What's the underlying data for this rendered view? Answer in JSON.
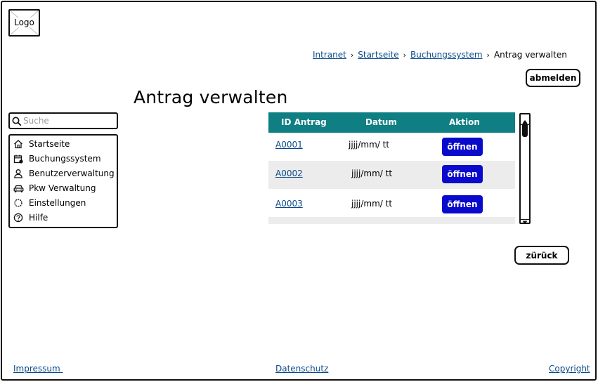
{
  "logo": {
    "text": "Logo"
  },
  "breadcrumb": {
    "items": [
      "Intranet",
      "Startseite",
      "Buchungssystem"
    ],
    "current": "Antrag verwalten",
    "separator": "›"
  },
  "header": {
    "logout_label": "abmelden"
  },
  "page": {
    "title": "Antrag verwalten"
  },
  "search": {
    "placeholder": "Suche",
    "value": ""
  },
  "sidebar": {
    "items": [
      {
        "label": "Startseite",
        "icon": "home-icon"
      },
      {
        "label": "Buchungssystem",
        "icon": "calendar-icon"
      },
      {
        "label": "Benutzerverwaltung",
        "icon": "user-icon"
      },
      {
        "label": "Pkw Verwaltung",
        "icon": "car-icon"
      },
      {
        "label": "Einstellungen",
        "icon": "gear-icon"
      },
      {
        "label": "Hilfe",
        "icon": "help-icon"
      }
    ]
  },
  "table": {
    "columns": [
      "ID Antrag",
      "Datum",
      "Aktion"
    ],
    "rows": [
      {
        "id": "A0001",
        "date": "jjjj/mm/ tt",
        "action": "öffnen"
      },
      {
        "id": "A0002",
        "date": "jjjj/mm/ tt",
        "action": "öffnen"
      },
      {
        "id": "A0003",
        "date": "jjjj/mm/ tt",
        "action": "öffnen"
      }
    ]
  },
  "actions": {
    "back_label": "zürück"
  },
  "footer": {
    "impressum": "Impressum ",
    "datenschutz": "Datenschutz",
    "copyright": "Copyright"
  },
  "colors": {
    "table_header": "#0f7f84",
    "button_blue": "#0a0acc",
    "link": "#0a4a8a",
    "row_alt": "#ececec"
  }
}
